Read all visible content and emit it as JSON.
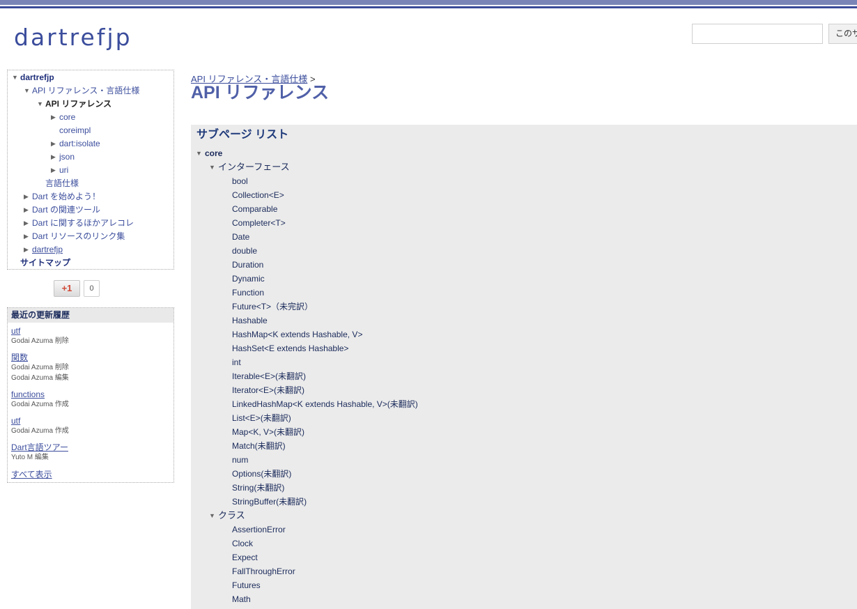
{
  "site": {
    "title": "dartrefjp",
    "search_button": "このサイトを検索"
  },
  "nav": {
    "items": [
      {
        "label": "dartrefjp",
        "indent": 0,
        "toggle": "open",
        "style": "bold"
      },
      {
        "label": "API リファレンス・言語仕様",
        "indent": 1,
        "toggle": "open",
        "style": "link"
      },
      {
        "label": "API リファレンス",
        "indent": 2,
        "toggle": "open",
        "style": "current"
      },
      {
        "label": "core",
        "indent": 3,
        "toggle": "closed",
        "style": "link"
      },
      {
        "label": "coreimpl",
        "indent": 3,
        "toggle": "none",
        "style": "link"
      },
      {
        "label": "dart:isolate",
        "indent": 3,
        "toggle": "closed",
        "style": "link"
      },
      {
        "label": "json",
        "indent": 3,
        "toggle": "closed",
        "style": "link"
      },
      {
        "label": "uri",
        "indent": 3,
        "toggle": "closed",
        "style": "link"
      },
      {
        "label": "言語仕様",
        "indent": 2,
        "toggle": "none",
        "style": "link"
      },
      {
        "label": "Dart を始めよう！",
        "indent": 1,
        "toggle": "closed",
        "style": "link"
      },
      {
        "label": "Dart の関連ツール",
        "indent": 1,
        "toggle": "closed",
        "style": "link"
      },
      {
        "label": "Dart に関するほかアレコレ",
        "indent": 1,
        "toggle": "closed",
        "style": "link"
      },
      {
        "label": "Dart リソースのリンク集",
        "indent": 1,
        "toggle": "closed",
        "style": "link"
      },
      {
        "label": "dartrefjp",
        "indent": 1,
        "toggle": "closed",
        "style": "underline"
      },
      {
        "label": "サイトマップ",
        "indent": 0,
        "toggle": "none",
        "style": "bold"
      }
    ]
  },
  "plusone": {
    "label": "+1",
    "count": "0"
  },
  "recent": {
    "title": "最近の更新履歴",
    "entries": [
      {
        "link": "utf",
        "meta": [
          "Godai Azuma 削除"
        ]
      },
      {
        "link": "関数",
        "meta": [
          "Godai Azuma 削除",
          "Godai Azuma 編集"
        ]
      },
      {
        "link": "functions",
        "meta": [
          "Godai Azuma 作成"
        ]
      },
      {
        "link": "utf",
        "meta": [
          "Godai Azuma 作成"
        ]
      },
      {
        "link": "Dart言語ツアー",
        "meta": [
          "Yuto M 編集"
        ]
      }
    ],
    "show_all": "すべて表示"
  },
  "breadcrumb": {
    "link": "API リファレンス・言語仕様",
    "sep": ">"
  },
  "page_title": "API リファレンス",
  "subpages": {
    "title": "サブページ リスト",
    "root": "core",
    "groups": [
      {
        "label": "インターフェース",
        "items": [
          "bool",
          "Collection<E>",
          "Comparable",
          "Completer<T>",
          "Date",
          "double",
          "Duration",
          "Dynamic",
          "Function",
          "Future<T>（未完訳）",
          "Hashable",
          "HashMap<K extends Hashable, V>",
          "HashSet<E extends Hashable>",
          "int",
          "Iterable<E>(未翻訳)",
          "Iterator<E>(未翻訳)",
          "LinkedHashMap<K extends Hashable, V>(未翻訳)",
          "List<E>(未翻訳)",
          "Map<K, V>(未翻訳)",
          "Match(未翻訳)",
          "num",
          "Options(未翻訳)",
          "String(未翻訳)",
          "StringBuffer(未翻訳)"
        ]
      },
      {
        "label": "クラス",
        "items": [
          "AssertionError",
          "Clock",
          "Expect",
          "FallThroughError",
          "Futures",
          "Math"
        ]
      }
    ]
  }
}
